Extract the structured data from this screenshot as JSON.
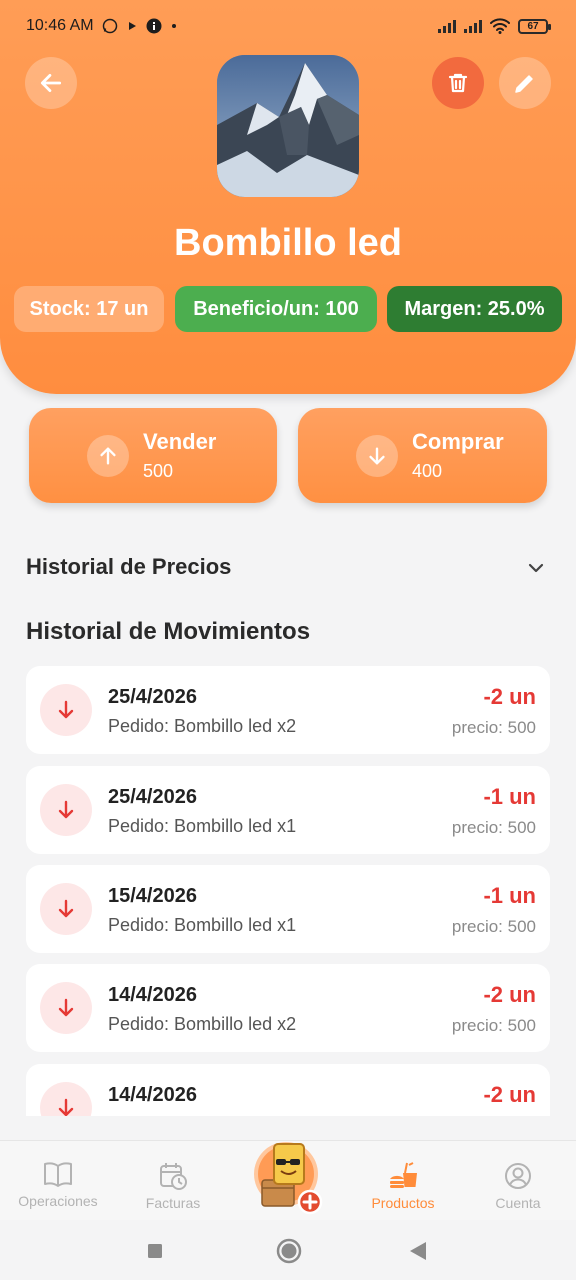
{
  "status_bar": {
    "time": "10:46 AM",
    "battery": "67",
    "icons": [
      "whatsapp-icon",
      "play-icon",
      "info-icon",
      "dot-icon",
      "signal-icon",
      "signal-icon",
      "wifi-icon",
      "battery-icon"
    ]
  },
  "header": {
    "colors": {
      "background": "#ff9149",
      "delete": "#f26a3e"
    },
    "product_name": "Bombillo led",
    "image": "mountain-photo",
    "chips": {
      "stock": "Stock: 17 un",
      "benefit": "Beneficio/un: 100",
      "margin": "Margen: 25.0%"
    }
  },
  "actions": {
    "sell": {
      "label": "Vender",
      "price": "500"
    },
    "buy": {
      "label": "Comprar",
      "price": "400"
    }
  },
  "sections": {
    "price_history": "Historial de Precios",
    "movements": "Historial de Movimientos"
  },
  "movements": [
    {
      "date": "25/4/2026",
      "desc": "Pedido: Bombillo led x2",
      "qty": "-2 un",
      "price": "precio: 500"
    },
    {
      "date": "25/4/2026",
      "desc": "Pedido: Bombillo led x1",
      "qty": "-1 un",
      "price": "precio: 500"
    },
    {
      "date": "15/4/2026",
      "desc": "Pedido: Bombillo led x1",
      "qty": "-1 un",
      "price": "precio: 500"
    },
    {
      "date": "14/4/2026",
      "desc": "Pedido: Bombillo led x2",
      "qty": "-2 un",
      "price": "precio: 500"
    },
    {
      "date": "14/4/2026",
      "desc": "",
      "qty": "-2 un",
      "price": ""
    }
  ],
  "nav": {
    "operations": "Operaciones",
    "invoices": "Facturas",
    "products": "Productos",
    "account": "Cuenta",
    "active": "Productos"
  }
}
